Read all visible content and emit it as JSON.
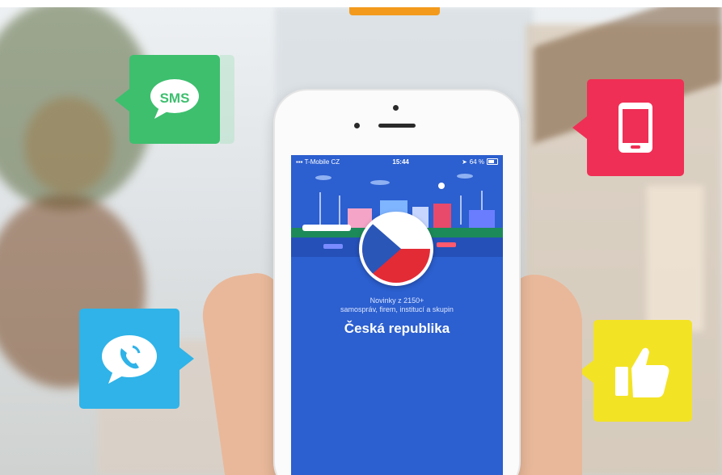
{
  "tiles": {
    "sms": {
      "label": "SMS",
      "color": "#3dbf6e"
    },
    "phone": {
      "icon": "smartphone-icon",
      "color": "#ef2f55"
    },
    "call": {
      "icon": "phone-call-icon",
      "color": "#2fb3e8"
    },
    "like": {
      "icon": "thumbs-up-icon",
      "color": "#f3e325"
    }
  },
  "phone_screen": {
    "status": {
      "carrier": "T-Mobile CZ",
      "time": "15:44",
      "battery": "64 %"
    },
    "subtitle_line1": "Novinky z 2150+",
    "subtitle_line2": "samospráv, firem, institucí a skupin",
    "title": "Česká republika",
    "flag": "czech-flag-icon",
    "background": "#2c5fcf"
  },
  "accent": {
    "orange": "#f39a1c"
  }
}
